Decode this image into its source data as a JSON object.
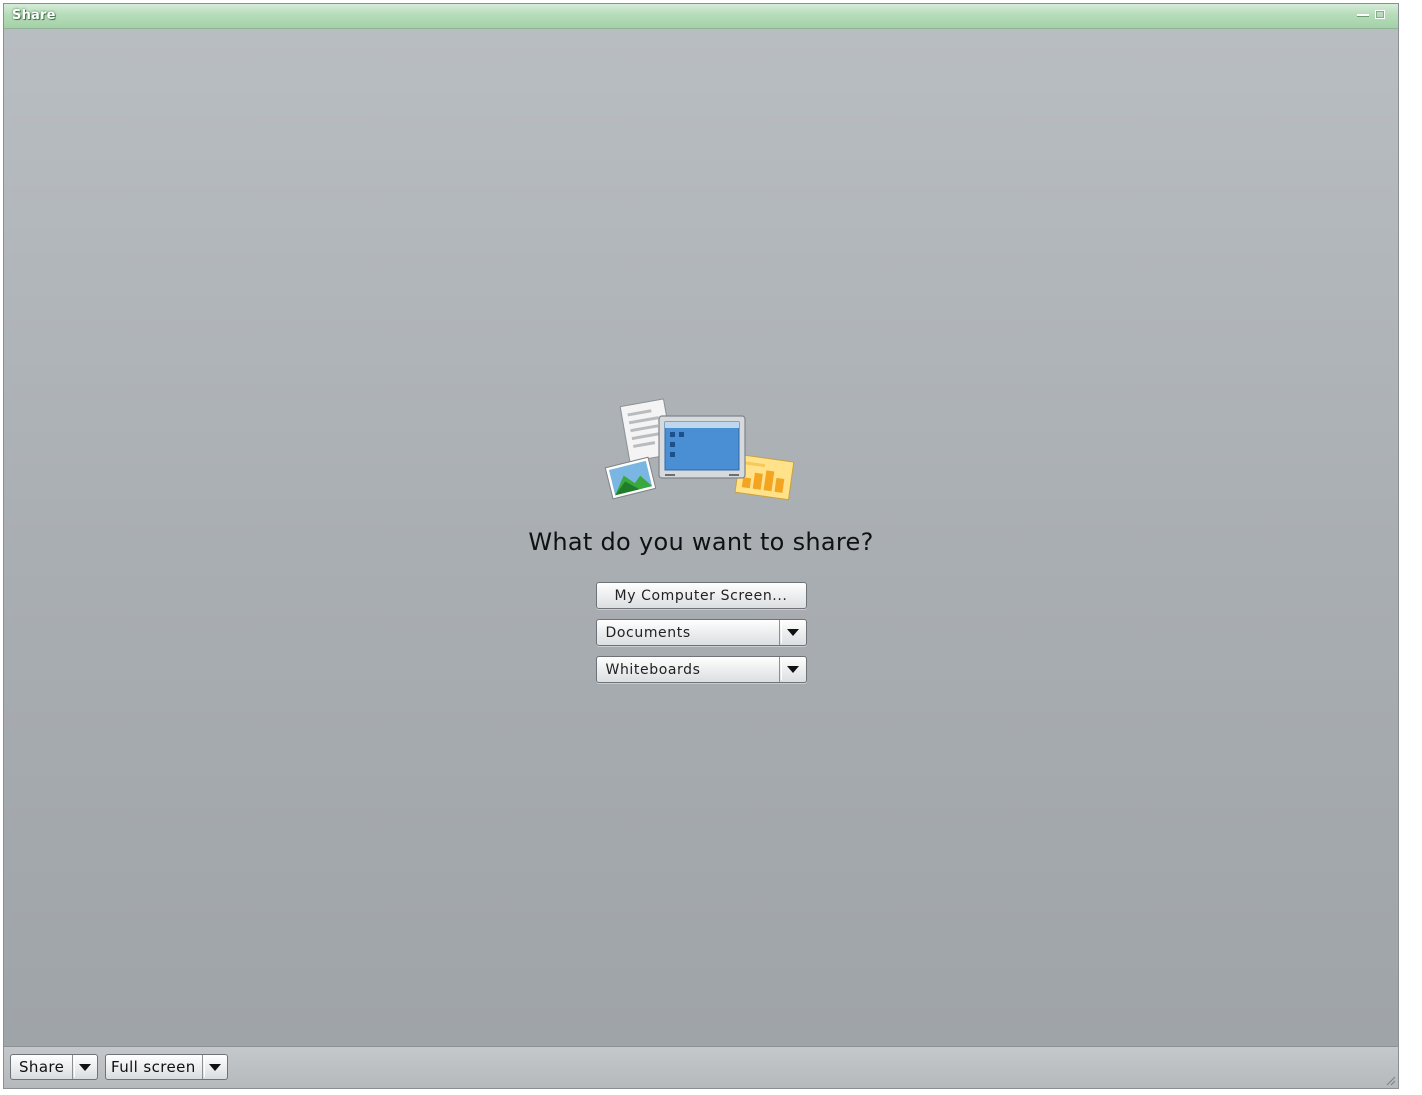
{
  "window": {
    "title": "Share"
  },
  "main": {
    "prompt": "What do you want to share?",
    "options": [
      {
        "label": "My Computer Screen...",
        "has_dropdown": false
      },
      {
        "label": "Documents",
        "has_dropdown": true
      },
      {
        "label": "Whiteboards",
        "has_dropdown": true
      }
    ],
    "illustration_icons": [
      "document-icon",
      "monitor-screen-icon",
      "photo-icon",
      "whiteboard-chart-icon"
    ]
  },
  "footer": {
    "share_label": "Share",
    "fullscreen_label": "Full screen"
  },
  "colors": {
    "titlebar": "#b5dcb9",
    "background": "#aeb3b7",
    "text": "#111111"
  }
}
